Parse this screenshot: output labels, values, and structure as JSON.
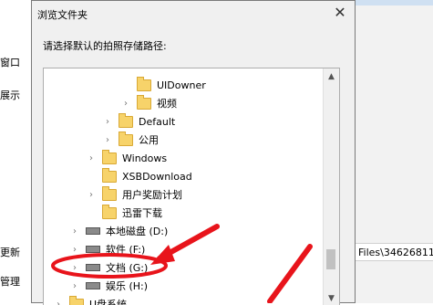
{
  "background": {
    "left_labels": [
      "窗口",
      "展示",
      "更新",
      "管理"
    ],
    "path_text": "Files\\34626811"
  },
  "dialog": {
    "title": "浏览文件夹",
    "prompt": "请选择默认的拍照存储路径:",
    "tree": [
      {
        "label": "UIDowner",
        "kind": "folder",
        "expand": false
      },
      {
        "label": "视频",
        "kind": "folder",
        "expand": true
      },
      {
        "label": "Default",
        "kind": "folder",
        "expand": true
      },
      {
        "label": "公用",
        "kind": "folder",
        "expand": true
      },
      {
        "label": "Windows",
        "kind": "folder",
        "expand": true
      },
      {
        "label": "XSBDownload",
        "kind": "folder",
        "expand": false
      },
      {
        "label": "用户奖励计划",
        "kind": "folder",
        "expand": true
      },
      {
        "label": "迅雷下载",
        "kind": "folder",
        "expand": false
      },
      {
        "label": "本地磁盘 (D:)",
        "kind": "drive",
        "expand": true
      },
      {
        "label": "软件 (F:)",
        "kind": "drive",
        "expand": true
      },
      {
        "label": "文档 (G:)",
        "kind": "drive",
        "expand": true
      },
      {
        "label": "娱乐 (H:)",
        "kind": "drive",
        "expand": true
      },
      {
        "label": "U盘系统",
        "kind": "folder",
        "expand": true
      }
    ]
  },
  "colors": {
    "annotation": "#e8141b",
    "folder": "#f7d36a"
  }
}
